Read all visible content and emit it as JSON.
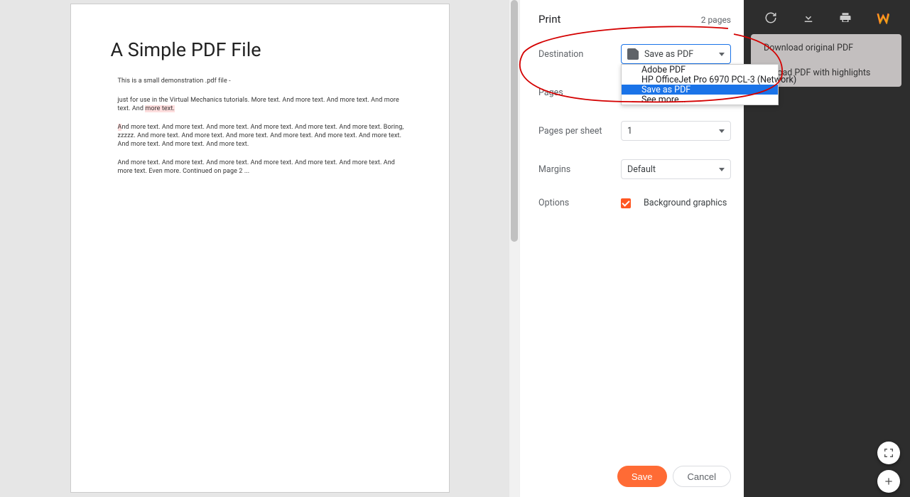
{
  "preview": {
    "title": "A Simple PDF File",
    "p1": "This is a small demonstration .pdf file -",
    "p2": "just for use in the Virtual Mechanics tutorials. More text. And more text. And more text. And more text. And ",
    "p2_hl": "more text.",
    "p3": "And more text. And more text. And more text. And more text. And more text. And more text. Boring, zzzzz. And more text. And more text. And more text. And more text. And more text. And more text. And more text. And more text. And more text.",
    "p4": "And more text. And more text. And more text. And more text. And more text. And more text. And more text. Even more. Continued on page 2 ...",
    "p3_first_word": "A"
  },
  "sidebar": {
    "title": "Print",
    "pages": "2 pages",
    "labels": {
      "destination": "Destination",
      "pages": "Pages",
      "pages_per_sheet": "Pages per sheet",
      "margins": "Margins",
      "options": "Options"
    },
    "destination": {
      "selected": "Save as PDF",
      "options": {
        "adobe": "Adobe PDF",
        "hp": "HP OfficeJet Pro 6970 PCL-3 (Network)",
        "save": "Save as PDF",
        "more": "See more..."
      }
    },
    "pages_value": "",
    "pps_value": "1",
    "margins_value": "Default",
    "bg_graphics": "Background graphics",
    "save": "Save",
    "cancel": "Cancel"
  },
  "tooltip": {
    "line1": "Download original PDF",
    "line2": "wnload PDF with highlights"
  }
}
